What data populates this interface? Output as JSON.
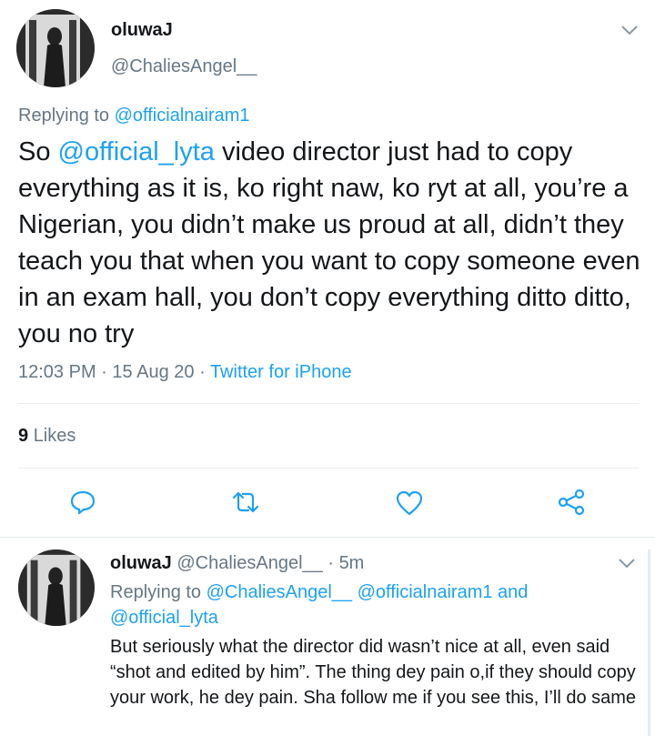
{
  "main_tweet": {
    "display_name": "oluwaJ",
    "handle": "@ChaliesAngel__",
    "replying_prefix": "Replying to",
    "replying_to": "@officialnairam1",
    "text_prefix": "So",
    "text_mention": "@official_lyta",
    "text_rest": " video director just had to copy everything as it is, ko right naw, ko ryt at all, you’re a Nigerian, you didn’t make us proud at all, didn’t they teach you that when you want to copy someone even in an exam hall, you don’t copy everything ditto ditto, you no try",
    "time": "12:03 PM",
    "sep1": "·",
    "date": "15 Aug 20",
    "sep2": "·",
    "client": "Twitter for iPhone",
    "likes_count": "9",
    "likes_label": "Likes"
  },
  "reply_tweet": {
    "display_name": "oluwaJ",
    "handle": "@ChaliesAngel__",
    "sep": "·",
    "age": "5m",
    "replying_prefix": "Replying to",
    "replying_to_1": "@ChaliesAngel__",
    "replying_to_2": "@officialnairam1",
    "and_label": "and",
    "replying_to_3": "@official_lyta",
    "text": "But seriously what the director did wasn’t nice at all, even said “shot and edited by him”. The thing dey pain o,if they should copy your work, he dey pain. Sha follow me if you see this, I’ll do same"
  },
  "icons": [
    "chevron-down-icon",
    "reply-icon",
    "retweet-icon",
    "like-icon",
    "share-icon"
  ],
  "colors": {
    "link": "#1da1f2",
    "muted": "#657786",
    "text": "#14171a",
    "divider": "#e6ecf0"
  }
}
